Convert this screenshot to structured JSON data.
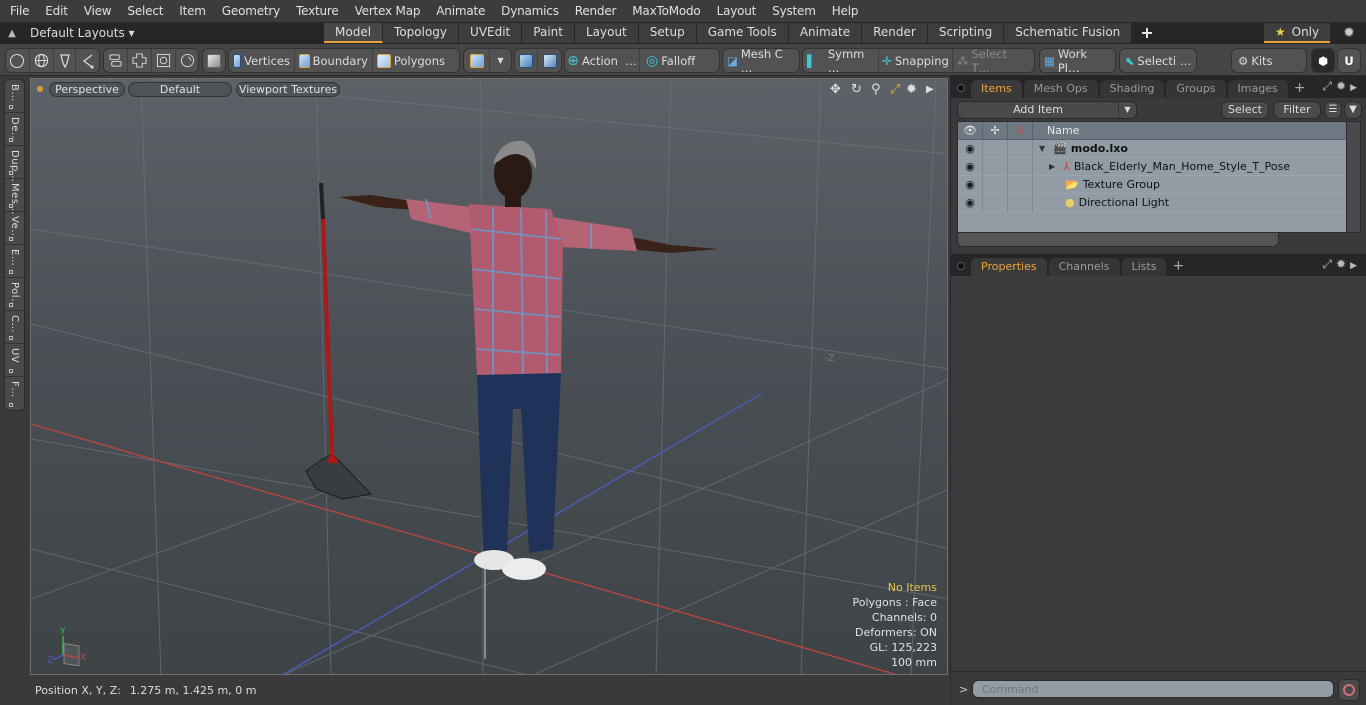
{
  "menubar": {
    "items": [
      "File",
      "Edit",
      "View",
      "Select",
      "Item",
      "Geometry",
      "Texture",
      "Vertex Map",
      "Animate",
      "Dynamics",
      "Render",
      "MaxToModo",
      "Layout",
      "System",
      "Help"
    ]
  },
  "layoutbar": {
    "layout_selector": "Default Layouts ▾",
    "tabs": [
      "Model",
      "Topology",
      "UVEdit",
      "Paint",
      "Layout",
      "Setup",
      "Game Tools",
      "Animate",
      "Render",
      "Scripting",
      "Schematic Fusion"
    ],
    "active_tab": "Model",
    "add_tab": "+",
    "only_label": "Only",
    "star_icon": "★",
    "gear_icon": "✹"
  },
  "toolbar": {
    "vertices": "Vertices",
    "boundary": "Boundary",
    "polygons": "Polygons",
    "action": "Action",
    "action_more": "…",
    "falloff": "Falloff",
    "mesh_c": "Mesh C …",
    "symm": "Symm …",
    "snapping": "Snapping",
    "select_t": "Select T…",
    "work_pl": "Work Pl…",
    "selecti": "Selecti …",
    "kits": "Kits"
  },
  "left_palette": {
    "tabs": [
      "B…",
      "De…",
      "Dup…",
      "Mes…",
      "Ve…",
      "E…",
      "Pol…",
      "C…",
      "UV",
      "F…"
    ]
  },
  "viewport": {
    "view_mode": "Perspective",
    "shading": "Default",
    "textures": "Viewport Textures",
    "axis_label_neg_z": "-Z",
    "info": {
      "selection": "No Items",
      "mode": "Polygons : Face",
      "channels": "Channels: 0",
      "deformers": "Deformers: ON",
      "gl": "GL: 125,223",
      "grid": "100 mm"
    },
    "gizmo": {
      "y": "Y",
      "z": "Z",
      "x": "X"
    },
    "colors": {
      "x_axis": "#c0463c",
      "z_axis": "#4a5ec4",
      "y_axis": "#3fc44a",
      "accent": "#e8a23c"
    }
  },
  "statusbar": {
    "label": "Position X, Y, Z:",
    "value": "1.275 m, 1.425 m, 0 m"
  },
  "items_panel": {
    "tabs": [
      "Items",
      "Mesh Ops",
      "Shading",
      "Groups",
      "Images"
    ],
    "active_tab": "Items",
    "add_tab": "+",
    "add_item": "Add Item",
    "select": "Select",
    "filter": "Filter",
    "column_name": "Name",
    "rows": [
      {
        "name": "modo.lxo",
        "icon": "scene-icon",
        "expander": "▼",
        "bold": true
      },
      {
        "name": "Black_Elderly_Man_Home_Style_T_Pose",
        "icon": "locator-icon",
        "expander": "▶"
      },
      {
        "name": "Texture Group",
        "icon": "folder-icon",
        "expander": ""
      },
      {
        "name": "Directional Light",
        "icon": "light-icon",
        "expander": ""
      }
    ]
  },
  "properties_panel": {
    "tabs": [
      "Properties",
      "Channels",
      "Lists"
    ],
    "active_tab": "Properties",
    "add_tab": "+"
  },
  "command_bar": {
    "prompt": ">",
    "placeholder": "Command"
  }
}
